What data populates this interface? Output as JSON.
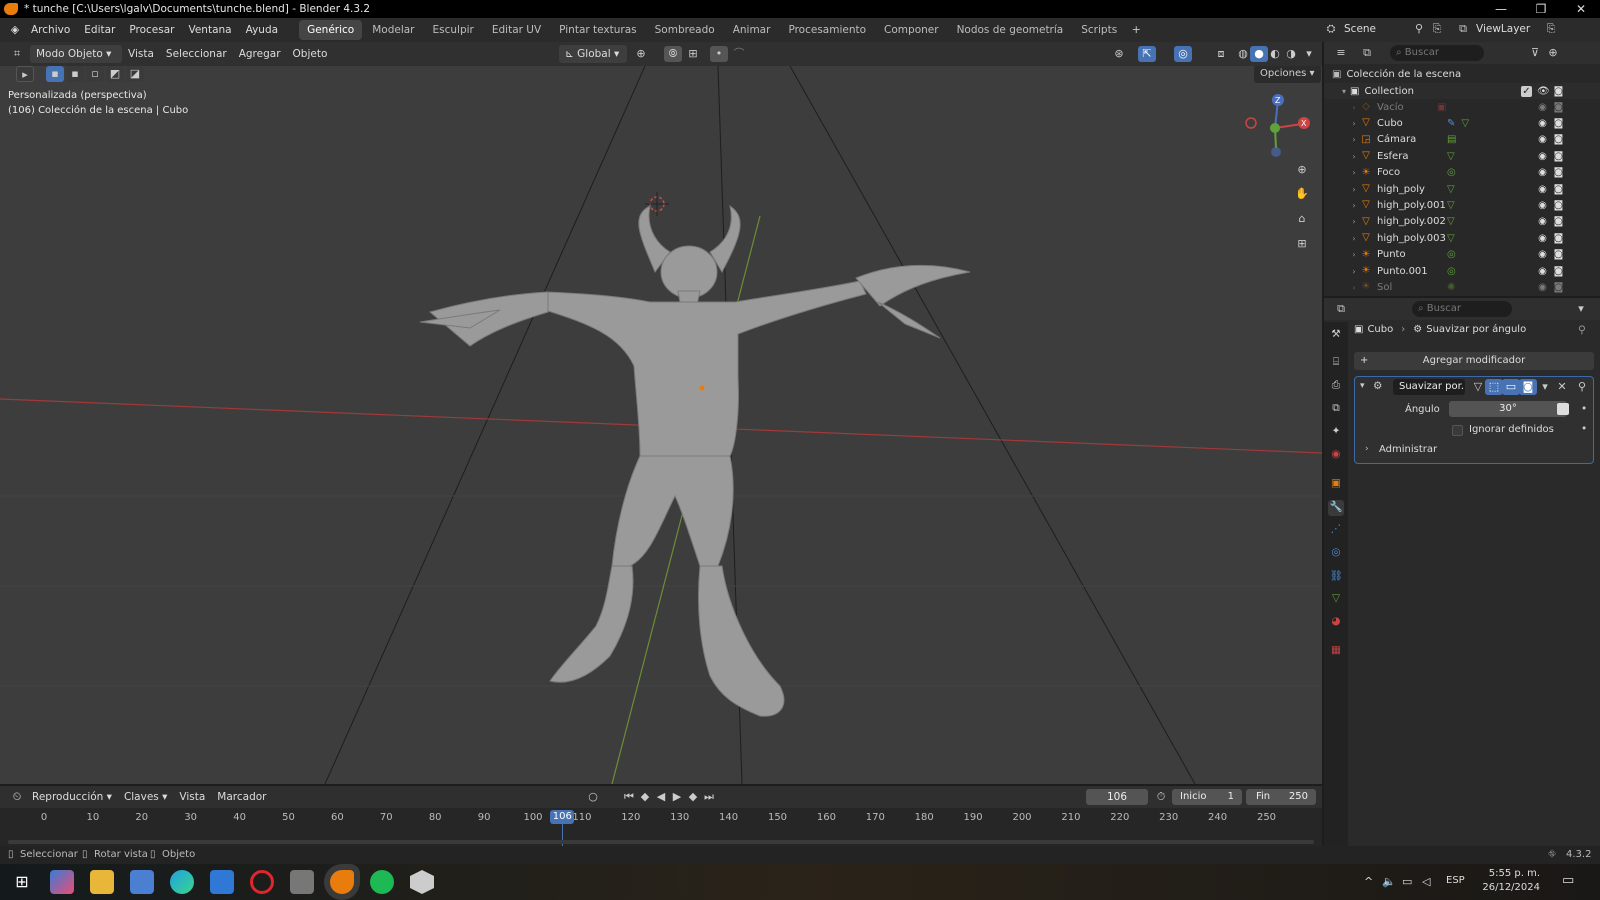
{
  "window": {
    "title": "* tunche [C:\\Users\\lgalv\\Documents\\tunche.blend] - Blender 4.3.2"
  },
  "menus": [
    "Archivo",
    "Editar",
    "Procesar",
    "Ventana",
    "Ayuda"
  ],
  "workspaces": [
    "Genérico",
    "Modelar",
    "Esculpir",
    "Editar UV",
    "Pintar texturas",
    "Sombreado",
    "Animar",
    "Procesamiento",
    "Componer",
    "Nodos de geometría",
    "Scripts"
  ],
  "scene": {
    "label": "Scene",
    "viewlayer": "ViewLayer"
  },
  "viewport_header": {
    "mode": "Modo Objeto",
    "menus": [
      "Vista",
      "Seleccionar",
      "Agregar",
      "Objeto"
    ],
    "orientation": "Global",
    "options": "Opciones"
  },
  "viewport": {
    "view_name": "Personalizada (perspectiva)",
    "collection_info": "(106) Colección de la escena | Cubo",
    "gizmo": {
      "z": "Z",
      "x": "X"
    }
  },
  "outliner": {
    "search_placeholder": "Buscar",
    "root": "Colección de la escena",
    "collection": "Collection",
    "items": [
      {
        "name": "Vacío"
      },
      {
        "name": "Cubo"
      },
      {
        "name": "Cámara"
      },
      {
        "name": "Esfera"
      },
      {
        "name": "Foco"
      },
      {
        "name": "high_poly"
      },
      {
        "name": "high_poly.001"
      },
      {
        "name": "high_poly.002"
      },
      {
        "name": "high_poly.003"
      },
      {
        "name": "Punto"
      },
      {
        "name": "Punto.001"
      },
      {
        "name": "Sol"
      }
    ]
  },
  "properties": {
    "search_placeholder": "Buscar",
    "breadcrumb_object": "Cubo",
    "breadcrumb_modifier": "Suavizar por ángulo",
    "add_modifier": "Agregar modificador",
    "modifier_name": "Suavizar por...",
    "angle_label": "Ángulo",
    "angle_value": "30°",
    "ignore_label": "Ignorar definidos",
    "manage_label": "Administrar"
  },
  "timeline": {
    "menus": [
      "Reproducción",
      "Claves",
      "Vista",
      "Marcador"
    ],
    "current_frame": "106",
    "start_label": "Inicio",
    "start_value": "1",
    "end_label": "Fin",
    "end_value": "250",
    "ticks": [
      "0",
      "10",
      "20",
      "30",
      "40",
      "50",
      "60",
      "70",
      "80",
      "90",
      "100",
      "110",
      "120",
      "130",
      "140",
      "150",
      "160",
      "170",
      "180",
      "190",
      "200",
      "210",
      "220",
      "230",
      "240",
      "250"
    ]
  },
  "statusbar": {
    "select": "Seleccionar",
    "rotate": "Rotar vista",
    "object": "Objeto",
    "version": "4.3.2"
  },
  "taskbar": {
    "lang": "ESP",
    "time": "5:55 p. m.",
    "date": "26/12/2024"
  },
  "colors": {
    "accent": "#4772b3",
    "orange": "#e87d0d",
    "viewport_bg": "#3d3d3d",
    "axis_x": "#d44b4b",
    "axis_y": "#7aa33f"
  }
}
